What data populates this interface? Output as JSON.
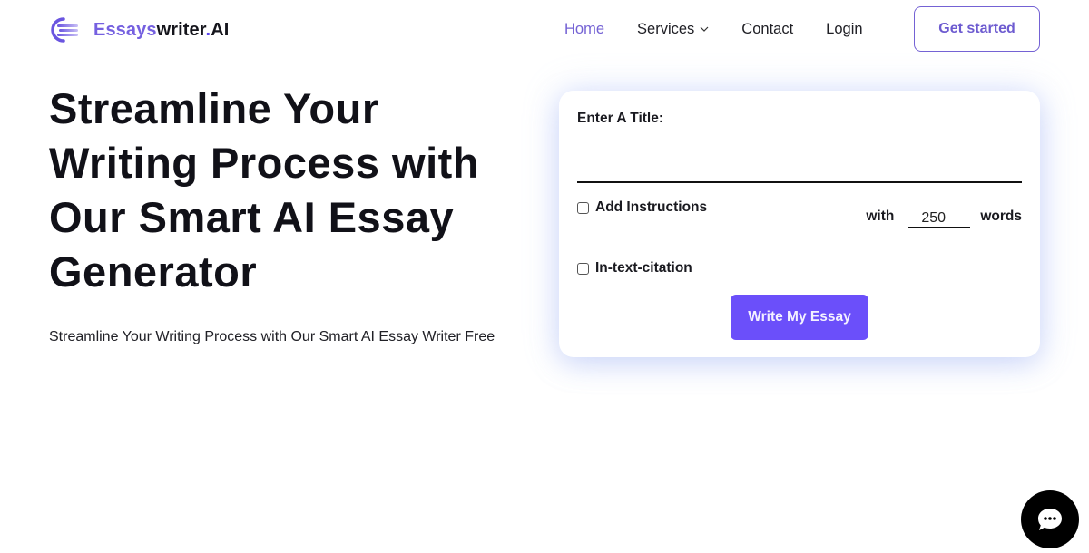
{
  "header": {
    "logo": {
      "brand": "Essays",
      "rest": "writer",
      "dot": ".",
      "suffix": "AI",
      "icon": "logo-stripes-icon"
    },
    "nav": [
      {
        "label": "Home",
        "active": true
      },
      {
        "label": "Services",
        "has_dropdown": true
      },
      {
        "label": "Contact"
      },
      {
        "label": "Login"
      }
    ],
    "cta_label": "Get started"
  },
  "hero": {
    "title_lines": [
      "Streamline Your",
      "Writing Process with",
      "Our Smart AI Essay",
      "Generator"
    ],
    "subtitle": "Streamline Your Writing Process with Our Smart AI Essay Writer Free"
  },
  "form": {
    "title_label": "Enter A Title:",
    "title_value": "",
    "add_instructions_label": "Add Instructions",
    "add_instructions_checked": false,
    "with_label": "with",
    "word_count": "250",
    "words_label": "words",
    "citation_label": "In-text-citation",
    "citation_checked": false,
    "submit_label": "Write My Essay"
  },
  "chat": {
    "icon": "chat-bubble-icon"
  },
  "colors": {
    "accent": "#6b4ffa",
    "nav_active": "#7462d4",
    "text": "#111118"
  }
}
